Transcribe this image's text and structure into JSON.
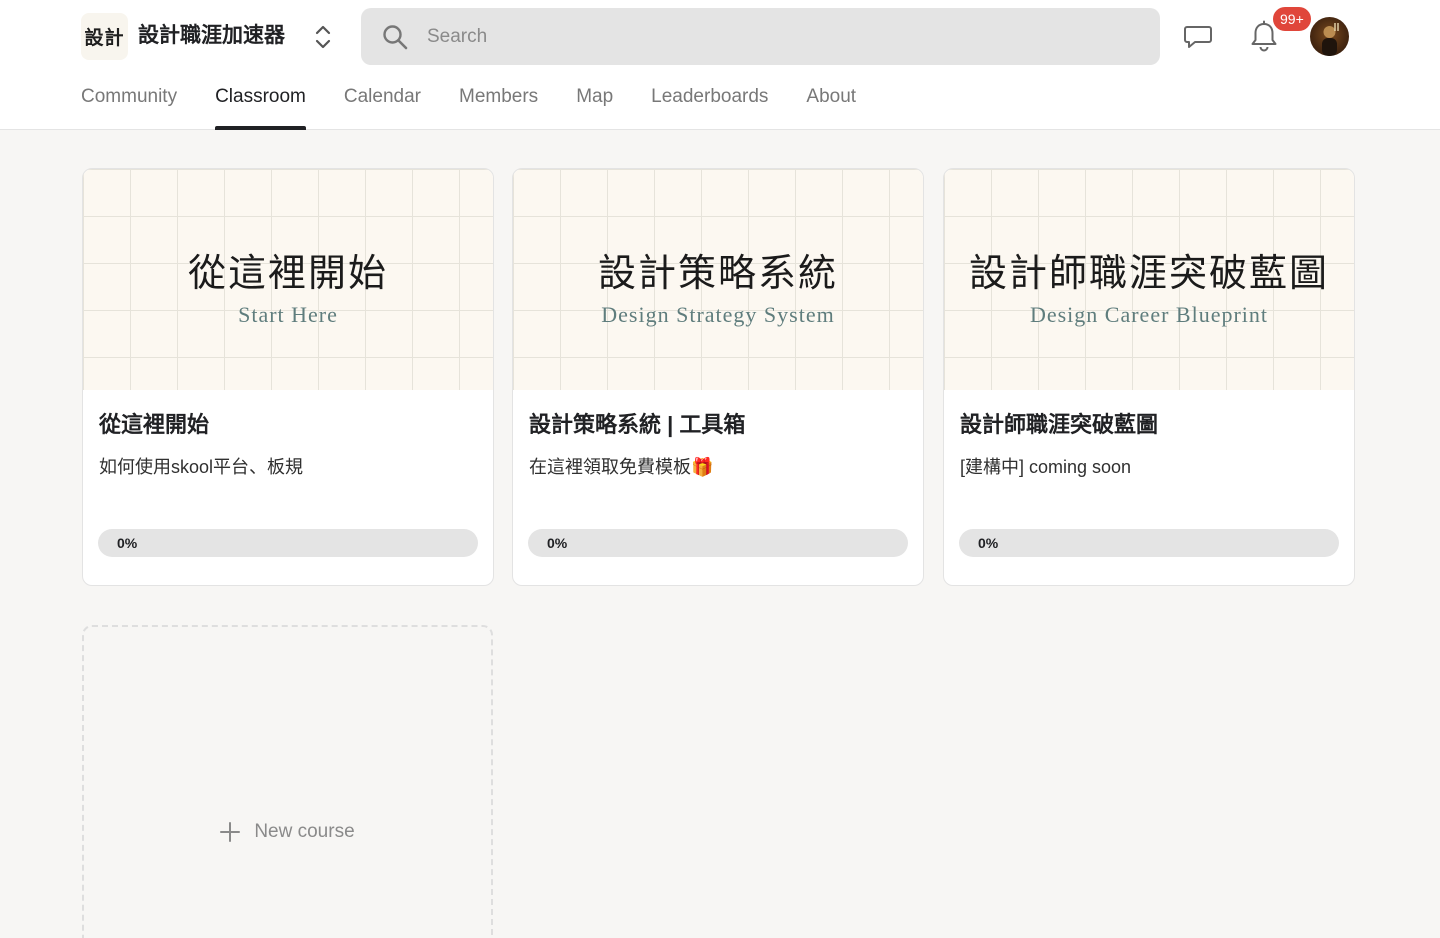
{
  "header": {
    "logo_text": "設計",
    "group_name": "設計職涯加速器",
    "search_placeholder": "Search",
    "notification_count": "99+",
    "icons": {
      "switcher": "chevron-up-down-icon",
      "search": "search-icon",
      "chat": "chat-icon",
      "bell": "bell-icon"
    }
  },
  "tabs": [
    {
      "label": "Community",
      "active": false
    },
    {
      "label": "Classroom",
      "active": true
    },
    {
      "label": "Calendar",
      "active": false
    },
    {
      "label": "Members",
      "active": false
    },
    {
      "label": "Map",
      "active": false
    },
    {
      "label": "Leaderboards",
      "active": false
    },
    {
      "label": "About",
      "active": false
    }
  ],
  "courses": [
    {
      "cover_title": "從這裡開始",
      "cover_subtitle": "Start Here",
      "title": "從這裡開始",
      "description": "如何使用skool平台、板規",
      "progress": 0,
      "progress_label": "0%"
    },
    {
      "cover_title": "設計策略系統",
      "cover_subtitle": "Design Strategy System",
      "title": "設計策略系統 | 工具箱",
      "description": "在這裡領取免費模板🎁",
      "progress": 0,
      "progress_label": "0%"
    },
    {
      "cover_title": "設計師職涯突破藍圖",
      "cover_subtitle": "Design Career Blueprint",
      "title": "設計師職涯突破藍圖",
      "description": "[建構中] coming soon",
      "progress": 0,
      "progress_label": "0%"
    }
  ],
  "new_course": {
    "label": "New course",
    "icon": "plus-icon"
  },
  "colors": {
    "accent_text": "#202124",
    "badge": "#e0463a",
    "cover_bg": "#fcf8f1",
    "cover_subtitle": "#5f7d7d",
    "progress_track": "#e4e4e4"
  }
}
